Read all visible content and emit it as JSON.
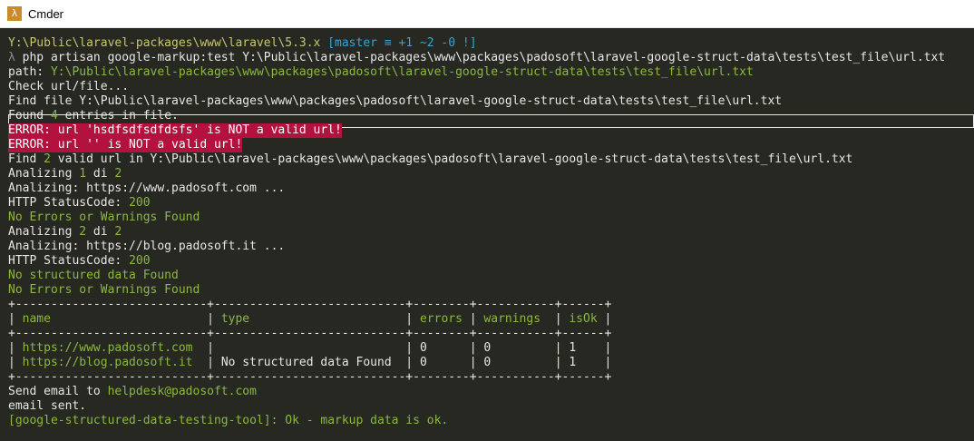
{
  "window": {
    "title": "Cmder"
  },
  "prompt": {
    "path": "Y:\\Public\\laravel-packages\\www\\laravel\\5.3.x",
    "branch": "[master ≡ +1 ~2 -0 !]",
    "lambda": "λ",
    "command": "php artisan google-markup:test Y:\\Public\\laravel-packages\\www\\packages\\padosoft\\laravel-google-struct-data\\tests\\test_file\\url.txt"
  },
  "output": {
    "path_label": "path:",
    "path_value": "Y:\\Public\\laravel-packages\\www\\packages\\padosoft\\laravel-google-struct-data\\tests\\test_file\\url.txt",
    "check": "Check url/file...",
    "find_file": "Find file Y:\\Public\\laravel-packages\\www\\packages\\padosoft\\laravel-google-struct-data\\tests\\test_file\\url.txt",
    "found_pre": "Found ",
    "found_n": "4",
    "found_post": " entries in file.",
    "error1": "ERROR: url 'hsdfsdfsdfdsfs' is NOT a valid url!",
    "error2": "ERROR: url '' is NOT a valid url!",
    "find_pre": "Find ",
    "find_n": "2",
    "find_post": " valid url in Y:\\Public\\laravel-packages\\www\\packages\\padosoft\\laravel-google-struct-data\\tests\\test_file\\url.txt",
    "an1_pre": "Analizing ",
    "an1_a": "1",
    "an1_mid": " di ",
    "an1_b": "2",
    "an1_url": "Analizing: https://www.padosoft.com ...",
    "status1_pre": "HTTP StatusCode: ",
    "status1": "200",
    "ok1": "No Errors or Warnings Found",
    "an2_pre": "Analizing ",
    "an2_a": "2",
    "an2_mid": " di ",
    "an2_b": "2",
    "an2_url": "Analizing: https://blog.padosoft.it ...",
    "status2_pre": "HTTP StatusCode: ",
    "status2": "200",
    "nostruct": "No structured data Found",
    "ok2": "No Errors or Warnings Found",
    "sep": "+---------------------------+---------------------------+--------+-----------+------+",
    "send_pre": "Send email to ",
    "email": "helpdesk@padosoft.com",
    "sent": "email sent.",
    "final": "[google-structured-data-testing-tool]: Ok - markup data is ok."
  },
  "table": {
    "headers": [
      "name",
      "type",
      "errors",
      "warnings",
      "isOk"
    ],
    "rows": [
      {
        "name": "https://www.padosoft.com",
        "type": "",
        "errors": "0",
        "warnings": "0",
        "isOk": "1"
      },
      {
        "name": "https://blog.padosoft.it",
        "type": "No structured data Found",
        "errors": "0",
        "warnings": "0",
        "isOk": "1"
      }
    ]
  }
}
